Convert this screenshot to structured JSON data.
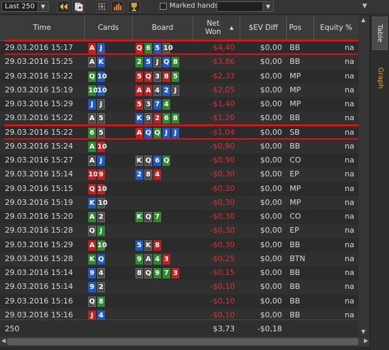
{
  "toolbar": {
    "range_select": "Last 250",
    "marked_hands_label": "Marked hands",
    "marked_select": ""
  },
  "vtabs": {
    "table": "Table",
    "graph": "Graph"
  },
  "columns": {
    "time": "Time",
    "cards": "Cards",
    "board": "Board",
    "net_won": "Net Won",
    "ev_diff": "$EV Diff",
    "pos": "Pos",
    "equity": "Equity %"
  },
  "colors": {
    "hearts": "#c41e1e",
    "diamonds": "#1f58c9",
    "clubs": "#2e8a2e",
    "spades": "#4a4a4a",
    "negative": "#e03030",
    "accent": "#f0a030"
  },
  "rows": [
    {
      "time": "29.03.2016 15:17",
      "cards": [
        [
          "A",
          "h"
        ],
        [
          "J",
          "d"
        ]
      ],
      "board": [
        [
          "Q",
          "h"
        ],
        [
          "6",
          "c"
        ],
        [
          "5",
          "d"
        ],
        [
          "10",
          "s"
        ]
      ],
      "net": "-$4,40",
      "ev": "$0,00",
      "pos": "BB",
      "eq": "na",
      "marked": true
    },
    {
      "time": "29.03.2016 15:25",
      "cards": [
        [
          "A",
          "s"
        ],
        [
          "K",
          "d"
        ]
      ],
      "board": [
        [
          "2",
          "c"
        ],
        [
          "5",
          "d"
        ],
        [
          "J",
          "s"
        ],
        [
          "Q",
          "d"
        ],
        [
          "8",
          "c"
        ]
      ],
      "net": "-$3,86",
      "ev": "$0,00",
      "pos": "BB",
      "eq": "na",
      "marked": false
    },
    {
      "time": "29.03.2016 15:22",
      "cards": [
        [
          "Q",
          "c"
        ],
        [
          "10",
          "d"
        ]
      ],
      "board": [
        [
          "5",
          "h"
        ],
        [
          "Q",
          "h"
        ],
        [
          "3",
          "s"
        ],
        [
          "8",
          "h"
        ],
        [
          "5",
          "c"
        ]
      ],
      "net": "-$2,33",
      "ev": "$0,00",
      "pos": "MP",
      "eq": "na",
      "marked": false
    },
    {
      "time": "29.03.2016 15:19",
      "cards": [
        [
          "10",
          "c"
        ],
        [
          "10",
          "d"
        ]
      ],
      "board": [
        [
          "A",
          "h"
        ],
        [
          "A",
          "h"
        ],
        [
          "4",
          "s"
        ],
        [
          "2",
          "d"
        ],
        [
          "J",
          "s"
        ]
      ],
      "net": "-$2,05",
      "ev": "$0,00",
      "pos": "MP",
      "eq": "na",
      "marked": false
    },
    {
      "time": "29.03.2016 15:29",
      "cards": [
        [
          "J",
          "d"
        ],
        [
          "J",
          "s"
        ]
      ],
      "board": [
        [
          "5",
          "h"
        ],
        [
          "3",
          "s"
        ],
        [
          "7",
          "d"
        ],
        [
          "4",
          "c"
        ]
      ],
      "net": "-$1,40",
      "ev": "$0,00",
      "pos": "MP",
      "eq": "na",
      "marked": false
    },
    {
      "time": "29.03.2016 15:22",
      "cards": [
        [
          "A",
          "s"
        ],
        [
          "5",
          "s"
        ]
      ],
      "board": [
        [
          "K",
          "d"
        ],
        [
          "9",
          "s"
        ],
        [
          "2",
          "h"
        ],
        [
          "6",
          "c"
        ],
        [
          "8",
          "c"
        ]
      ],
      "net": "-$1,20",
      "ev": "$0,00",
      "pos": "BB",
      "eq": "na",
      "marked": false
    },
    {
      "time": "29.03.2016 15:22",
      "cards": [
        [
          "6",
          "c"
        ],
        [
          "5",
          "s"
        ]
      ],
      "board": [
        [
          "A",
          "h"
        ],
        [
          "Q",
          "d"
        ],
        [
          "Q",
          "c"
        ],
        [
          "J",
          "d"
        ],
        [
          "J",
          "d"
        ]
      ],
      "net": "-$1,04",
      "ev": "$0,00",
      "pos": "SB",
      "eq": "na",
      "marked": true
    },
    {
      "time": "29.03.2016 15:24",
      "cards": [
        [
          "A",
          "c"
        ],
        [
          "10",
          "h"
        ]
      ],
      "board": [],
      "net": "-$0,90",
      "ev": "$0,00",
      "pos": "BB",
      "eq": "na",
      "marked": false
    },
    {
      "time": "29.03.2016 15:27",
      "cards": [
        [
          "A",
          "s"
        ],
        [
          "J",
          "d"
        ]
      ],
      "board": [
        [
          "K",
          "s"
        ],
        [
          "Q",
          "s"
        ],
        [
          "6",
          "d"
        ],
        [
          "Q",
          "c"
        ]
      ],
      "net": "-$0,90",
      "ev": "$0,00",
      "pos": "CO",
      "eq": "na",
      "marked": false
    },
    {
      "time": "29.03.2016 15:14",
      "cards": [
        [
          "10",
          "h"
        ],
        [
          "9",
          "h"
        ]
      ],
      "board": [
        [
          "2",
          "d"
        ],
        [
          "8",
          "s"
        ],
        [
          "4",
          "h"
        ]
      ],
      "net": "-$0,30",
      "ev": "$0,00",
      "pos": "EP",
      "eq": "na",
      "marked": false
    },
    {
      "time": "29.03.2016 15:15",
      "cards": [
        [
          "Q",
          "h"
        ],
        [
          "10",
          "h"
        ]
      ],
      "board": [],
      "net": "-$0,30",
      "ev": "$0,00",
      "pos": "MP",
      "eq": "na",
      "marked": false
    },
    {
      "time": "29.03.2016 15:19",
      "cards": [
        [
          "K",
          "d"
        ],
        [
          "10",
          "s"
        ]
      ],
      "board": [],
      "net": "-$0,30",
      "ev": "$0,00",
      "pos": "MP",
      "eq": "na",
      "marked": false
    },
    {
      "time": "29.03.2016 15:20",
      "cards": [
        [
          "A",
          "c"
        ],
        [
          "2",
          "s"
        ]
      ],
      "board": [
        [
          "K",
          "c"
        ],
        [
          "Q",
          "s"
        ],
        [
          "7",
          "c"
        ]
      ],
      "net": "-$0,30",
      "ev": "$0,00",
      "pos": "CO",
      "eq": "na",
      "marked": false
    },
    {
      "time": "29.03.2016 15:28",
      "cards": [
        [
          "Q",
          "s"
        ],
        [
          "J",
          "c"
        ]
      ],
      "board": [],
      "net": "-$0,30",
      "ev": "$0,00",
      "pos": "EP",
      "eq": "na",
      "marked": false
    },
    {
      "time": "29.03.2016 15:29",
      "cards": [
        [
          "A",
          "h"
        ],
        [
          "10",
          "c"
        ]
      ],
      "board": [
        [
          "5",
          "d"
        ],
        [
          "K",
          "s"
        ],
        [
          "8",
          "h"
        ]
      ],
      "net": "-$0,30",
      "ev": "$0,00",
      "pos": "BB",
      "eq": "na",
      "marked": false
    },
    {
      "time": "29.03.2016 15:28",
      "cards": [
        [
          "K",
          "c"
        ],
        [
          "Q",
          "d"
        ]
      ],
      "board": [
        [
          "9",
          "c"
        ],
        [
          "A",
          "s"
        ],
        [
          "4",
          "c"
        ],
        [
          "3",
          "h"
        ]
      ],
      "net": "-$0,25",
      "ev": "$0,00",
      "pos": "BTN",
      "eq": "na",
      "marked": false
    },
    {
      "time": "29.03.2016 15:14",
      "cards": [
        [
          "9",
          "d"
        ],
        [
          "4",
          "s"
        ]
      ],
      "board": [
        [
          "8",
          "s"
        ],
        [
          "Q",
          "s"
        ],
        [
          "9",
          "c"
        ],
        [
          "7",
          "c"
        ],
        [
          "3",
          "h"
        ]
      ],
      "net": "-$0,15",
      "ev": "$0,00",
      "pos": "BB",
      "eq": "na",
      "marked": false
    },
    {
      "time": "29.03.2016 15:14",
      "cards": [
        [
          "9",
          "d"
        ],
        [
          "2",
          "s"
        ]
      ],
      "board": [],
      "net": "-$0,10",
      "ev": "$0,00",
      "pos": "BB",
      "eq": "na",
      "marked": false
    },
    {
      "time": "29.03.2016 15:16",
      "cards": [
        [
          "Q",
          "s"
        ],
        [
          "8",
          "c"
        ]
      ],
      "board": [],
      "net": "-$0,10",
      "ev": "$0,00",
      "pos": "BB",
      "eq": "na",
      "marked": false
    },
    {
      "time": "29.03.2016 15:16",
      "cards": [
        [
          "J",
          "h"
        ],
        [
          "4",
          "d"
        ]
      ],
      "board": [],
      "net": "-$0,10",
      "ev": "$0,00",
      "pos": "BB",
      "eq": "na",
      "marked": false
    }
  ],
  "footer": {
    "count": "250",
    "net_total": "$3,73",
    "ev_total": "-$0,18"
  }
}
